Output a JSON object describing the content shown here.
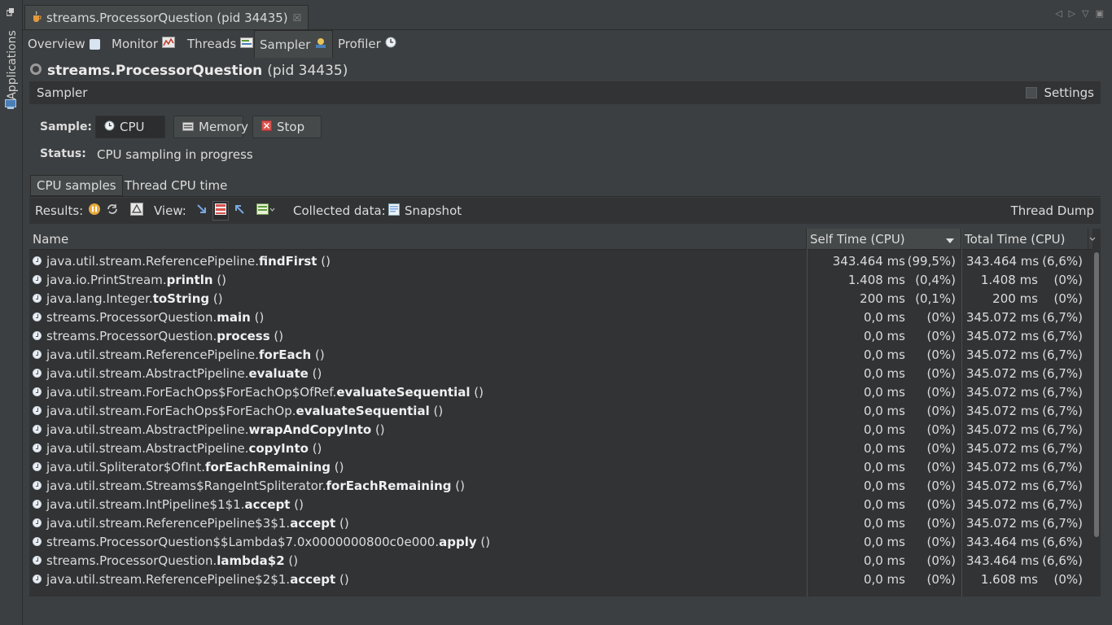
{
  "left_strip": {
    "apps_label": "Applications"
  },
  "document_tab": {
    "title": "streams.ProcessorQuestion (pid 34435)"
  },
  "sub_tabs": [
    {
      "label": "Overview"
    },
    {
      "label": "Monitor"
    },
    {
      "label": "Threads"
    },
    {
      "label": "Sampler"
    },
    {
      "label": "Profiler"
    }
  ],
  "process": {
    "name": "streams.ProcessorQuestion",
    "pid": "(pid 34435)"
  },
  "sampler": {
    "header": "Sampler",
    "settings_label": "Settings",
    "sample_label": "Sample:",
    "cpu_button": "CPU",
    "memory_button": "Memory",
    "stop_button": "Stop",
    "status_label": "Status:",
    "status_value": "CPU sampling in progress"
  },
  "inner_tabs": [
    {
      "label": "CPU samples"
    },
    {
      "label": "Thread CPU time"
    }
  ],
  "results_bar": {
    "results_label": "Results:",
    "view_label": "View:",
    "collected_label": "Collected data:",
    "snapshot_label": "Snapshot",
    "thread_dump_label": "Thread Dump"
  },
  "table": {
    "columns": {
      "name": "Name",
      "self": "Self Time (CPU)",
      "total": "Total Time (CPU)"
    },
    "rows": [
      {
        "prefix": "java.util.stream.ReferencePipeline.",
        "method": "findFirst",
        "suffix": " ()",
        "self": "343.464 ms",
        "self_pct": "(99,5%)",
        "total": "343.464 ms",
        "total_pct": "(6,6%)"
      },
      {
        "prefix": "java.io.PrintStream.",
        "method": "println",
        "suffix": " ()",
        "self": "1.408 ms",
        "self_pct": "(0,4%)",
        "total": "1.408 ms",
        "total_pct": "(0%)"
      },
      {
        "prefix": "java.lang.Integer.",
        "method": "toString",
        "suffix": " ()",
        "self": "200 ms",
        "self_pct": "(0,1%)",
        "total": "200 ms",
        "total_pct": "(0%)"
      },
      {
        "prefix": "streams.ProcessorQuestion.",
        "method": "main",
        "suffix": " ()",
        "self": "0,0 ms",
        "self_pct": "(0%)",
        "total": "345.072 ms",
        "total_pct": "(6,7%)"
      },
      {
        "prefix": "streams.ProcessorQuestion.",
        "method": "process",
        "suffix": " ()",
        "self": "0,0 ms",
        "self_pct": "(0%)",
        "total": "345.072 ms",
        "total_pct": "(6,7%)"
      },
      {
        "prefix": "java.util.stream.ReferencePipeline.",
        "method": "forEach",
        "suffix": " ()",
        "self": "0,0 ms",
        "self_pct": "(0%)",
        "total": "345.072 ms",
        "total_pct": "(6,7%)"
      },
      {
        "prefix": "java.util.stream.AbstractPipeline.",
        "method": "evaluate",
        "suffix": " ()",
        "self": "0,0 ms",
        "self_pct": "(0%)",
        "total": "345.072 ms",
        "total_pct": "(6,7%)"
      },
      {
        "prefix": "java.util.stream.ForEachOps$ForEachOp$OfRef.",
        "method": "evaluateSequential",
        "suffix": " ()",
        "self": "0,0 ms",
        "self_pct": "(0%)",
        "total": "345.072 ms",
        "total_pct": "(6,7%)"
      },
      {
        "prefix": "java.util.stream.ForEachOps$ForEachOp.",
        "method": "evaluateSequential",
        "suffix": " ()",
        "self": "0,0 ms",
        "self_pct": "(0%)",
        "total": "345.072 ms",
        "total_pct": "(6,7%)"
      },
      {
        "prefix": "java.util.stream.AbstractPipeline.",
        "method": "wrapAndCopyInto",
        "suffix": " ()",
        "self": "0,0 ms",
        "self_pct": "(0%)",
        "total": "345.072 ms",
        "total_pct": "(6,7%)"
      },
      {
        "prefix": "java.util.stream.AbstractPipeline.",
        "method": "copyInto",
        "suffix": " ()",
        "self": "0,0 ms",
        "self_pct": "(0%)",
        "total": "345.072 ms",
        "total_pct": "(6,7%)"
      },
      {
        "prefix": "java.util.Spliterator$OfInt.",
        "method": "forEachRemaining",
        "suffix": " ()",
        "self": "0,0 ms",
        "self_pct": "(0%)",
        "total": "345.072 ms",
        "total_pct": "(6,7%)"
      },
      {
        "prefix": "java.util.stream.Streams$RangeIntSpliterator.",
        "method": "forEachRemaining",
        "suffix": " ()",
        "self": "0,0 ms",
        "self_pct": "(0%)",
        "total": "345.072 ms",
        "total_pct": "(6,7%)"
      },
      {
        "prefix": "java.util.stream.IntPipeline$1$1.",
        "method": "accept",
        "suffix": " ()",
        "self": "0,0 ms",
        "self_pct": "(0%)",
        "total": "345.072 ms",
        "total_pct": "(6,7%)"
      },
      {
        "prefix": "java.util.stream.ReferencePipeline$3$1.",
        "method": "accept",
        "suffix": " ()",
        "self": "0,0 ms",
        "self_pct": "(0%)",
        "total": "345.072 ms",
        "total_pct": "(6,7%)"
      },
      {
        "prefix": "streams.ProcessorQuestion$$Lambda$7.0x0000000800c0e000.",
        "method": "apply",
        "suffix": " ()",
        "self": "0,0 ms",
        "self_pct": "(0%)",
        "total": "343.464 ms",
        "total_pct": "(6,6%)"
      },
      {
        "prefix": "streams.ProcessorQuestion.",
        "method": "lambda$2",
        "suffix": " ()",
        "self": "0,0 ms",
        "self_pct": "(0%)",
        "total": "343.464 ms",
        "total_pct": "(6,6%)"
      },
      {
        "prefix": "java.util.stream.ReferencePipeline$2$1.",
        "method": "accept",
        "suffix": " ()",
        "self": "0,0 ms",
        "self_pct": "(0%)",
        "total": "1.608 ms",
        "total_pct": "(0%)"
      }
    ]
  },
  "colors": {
    "background": "#3c3f41",
    "panel": "#313335",
    "text": "#dcdcdc",
    "stop_red": "#d9534f"
  }
}
